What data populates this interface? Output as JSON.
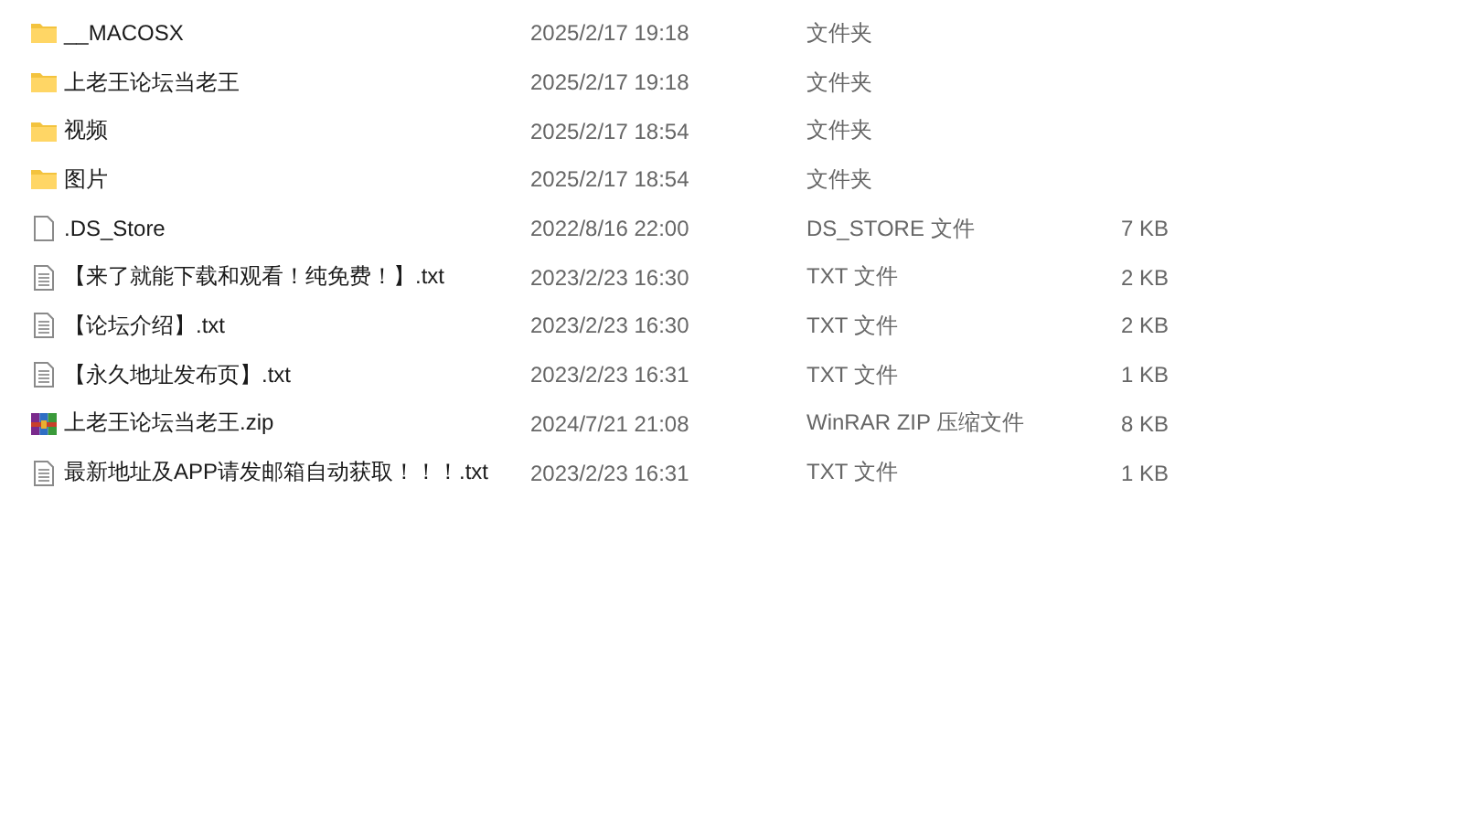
{
  "files": [
    {
      "kind": "folder",
      "name": "__MACOSX",
      "modified": "2025/2/17 19:18",
      "type": "文件夹"
    },
    {
      "kind": "folder",
      "name": "上老王论坛当老王",
      "modified": "2025/2/17 19:18",
      "type": "文件夹"
    },
    {
      "kind": "folder",
      "name": "视频",
      "modified": "2025/2/17 18:54",
      "type": "文件夹"
    },
    {
      "kind": "folder",
      "name": "图片",
      "modified": "2025/2/17 18:54",
      "type": "文件夹"
    },
    {
      "kind": "file",
      "name": ".DS_Store",
      "modified": "2022/8/16 22:00",
      "type": "DS_STORE 文件",
      "size": "7 KB"
    },
    {
      "kind": "text",
      "name": "【来了就能下载和观看！纯免费！】.txt",
      "modified": "2023/2/23 16:30",
      "type": "TXT 文件",
      "size": "2 KB"
    },
    {
      "kind": "text",
      "name": "【论坛介绍】.txt",
      "modified": "2023/2/23 16:30",
      "type": "TXT 文件",
      "size": "2 KB"
    },
    {
      "kind": "text",
      "name": "【永久地址发布页】.txt",
      "modified": "2023/2/23 16:31",
      "type": "TXT 文件",
      "size": "1 KB"
    },
    {
      "kind": "archive",
      "name": "上老王论坛当老王.zip",
      "modified": "2024/7/21 21:08",
      "type": "WinRAR ZIP 压缩文件",
      "size": "8 KB"
    },
    {
      "kind": "text",
      "name": "最新地址及APP请发邮箱自动获取！！！.txt",
      "modified": "2023/2/23 16:31",
      "type": "TXT 文件",
      "size": "1 KB"
    }
  ]
}
